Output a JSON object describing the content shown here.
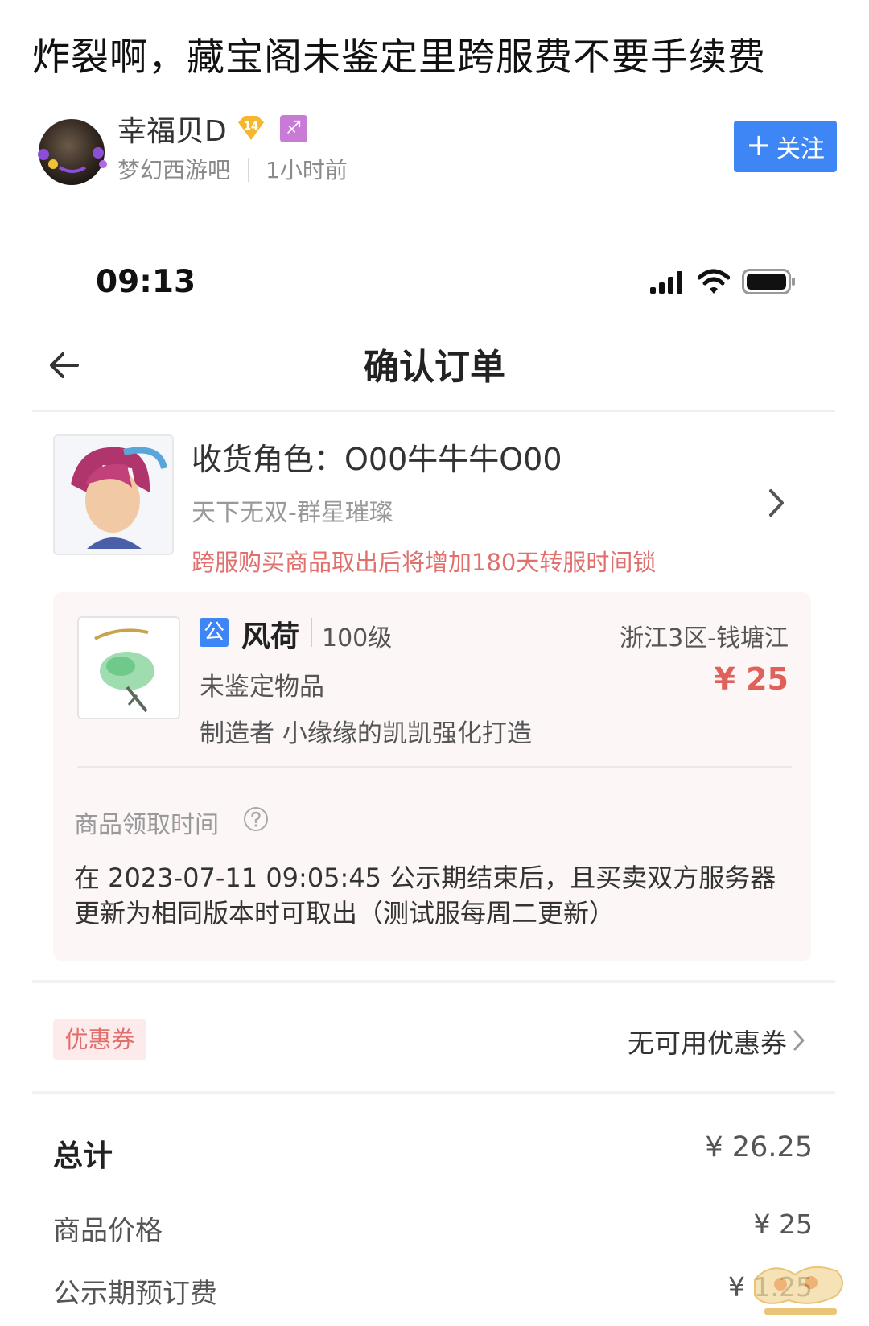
{
  "post": {
    "title": "炸裂啊，藏宝阁未鉴定里跨服费不要手续费",
    "author_name": "幸福贝D",
    "level_badge": "14",
    "forum": "梦幻西游吧",
    "time": "1小时前",
    "follow_label": "关注"
  },
  "status_bar": {
    "time": "09:13"
  },
  "nav": {
    "title": "确认订单"
  },
  "receiver": {
    "label_line": "收货角色：O00牛牛牛O00",
    "server": "天下无双-群星璀璨",
    "warning": "跨服购买商品取出后将增加180天转服时间锁"
  },
  "item": {
    "tag": "公",
    "name": "风荷",
    "level": "100级",
    "server": "浙江3区-钱塘江",
    "status": "未鉴定物品",
    "price": "¥ 25",
    "maker": "制造者 小缘缘的凯凯强化打造",
    "pickup_label": "商品领取时间",
    "pickup_desc_line1": "在 2023-07-11 09:05:45 公示期结束后，且买卖双方服务器",
    "pickup_desc_line2": "更新为相同版本时可取出（测试服每周二更新）"
  },
  "coupon": {
    "tag": "优惠券",
    "value": "无可用优惠券"
  },
  "totals": {
    "total_label": "总计",
    "total_value": "¥ 26.25",
    "price_label": "商品价格",
    "price_value": "¥ 25",
    "fee_label": "公示期预订费",
    "fee_value": "¥ 1.25"
  },
  "colors": {
    "accent_blue": "#3e86f5",
    "warning_red": "#e0706e",
    "price_red": "#e0605a",
    "card_bg": "#fcf6f6"
  }
}
